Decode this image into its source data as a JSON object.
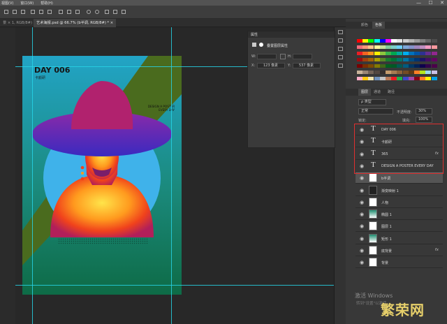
{
  "menubar": {
    "items": [
      "视图(V)",
      "窗口(W)",
      "帮助(H)"
    ]
  },
  "window_controls": {
    "minimize": "—",
    "maximize": "☐",
    "close": "✕"
  },
  "tabs": [
    {
      "label": "景 × 1, RGB/8#)"
    },
    {
      "label": "艺术海报.psd @ 66.7% (b半调, RGB/8#) * ×"
    }
  ],
  "poster": {
    "title": "DAY  006",
    "subtitle": "卡颜研",
    "tagline_line1": "DESIGN A POSTER",
    "tagline_line2": "EVERY DAY"
  },
  "properties": {
    "title": "属性",
    "section": "叠置图层属性",
    "w_label": "W:",
    "h_label": "H:",
    "x_label": "X:",
    "x_value": "123 像素",
    "y_label": "Y:",
    "y_value": "537 像素"
  },
  "color_panel": {
    "tabs": [
      "颜色",
      "色板"
    ]
  },
  "layers_panel": {
    "tabs": [
      "图层",
      "通道",
      "路径"
    ],
    "filter_kind": "ρ 类型",
    "blend_mode": "正常",
    "opacity_label": "不透明度:",
    "opacity_value": "30%",
    "lock_label": "锁定:",
    "fill_label": "填充:",
    "fill_value": "100%",
    "layers": [
      {
        "name": "DAY  006",
        "type": "text",
        "fx": ""
      },
      {
        "name": "卡颜研",
        "type": "text",
        "fx": ""
      },
      {
        "name": "365",
        "type": "text",
        "fx": "fx"
      },
      {
        "name": "DESIGN A POSTER EVERY DAY",
        "type": "text",
        "fx": ""
      },
      {
        "name": "b半调",
        "type": "image",
        "fx": ""
      },
      {
        "name": "渐变映射 1",
        "type": "adjust",
        "fx": ""
      },
      {
        "name": "人物",
        "type": "image",
        "fx": ""
      },
      {
        "name": "椭圆 1",
        "type": "shape",
        "fx": ""
      },
      {
        "name": "图层 1",
        "type": "image",
        "fx": ""
      },
      {
        "name": "矩形 1",
        "type": "shape",
        "fx": ""
      },
      {
        "name": "底背景",
        "type": "image",
        "fx": "fx"
      },
      {
        "name": "背景",
        "type": "image",
        "fx": ""
      }
    ]
  },
  "watermark": {
    "line1": "激活 Windows",
    "line2": "转到\"设置\"以激活..."
  },
  "brand": {
    "text": "繁荣网"
  }
}
